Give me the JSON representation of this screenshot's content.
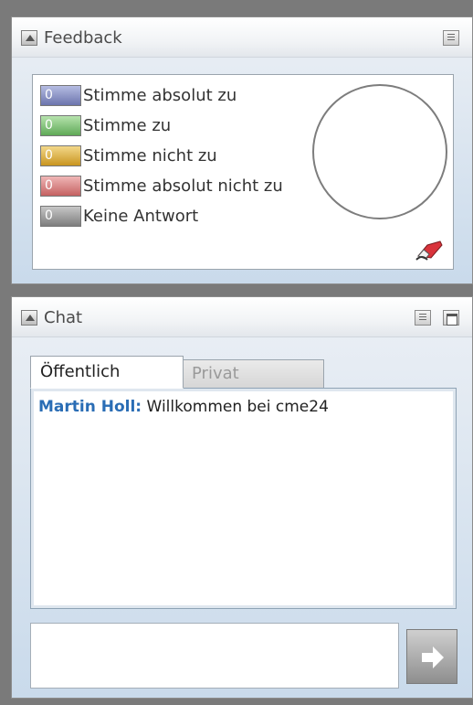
{
  "feedback": {
    "title": "Feedback",
    "legend": [
      {
        "label": "Stimme absolut zu",
        "count": "0",
        "color": "#8a93c4"
      },
      {
        "label": "Stimme zu",
        "count": "0",
        "color": "#7fbf78"
      },
      {
        "label": "Stimme nicht zu",
        "count": "0",
        "color": "#e0b63a"
      },
      {
        "label": "Stimme absolut nicht zu",
        "count": "0",
        "color": "#d98384"
      },
      {
        "label": "Keine Antwort",
        "count": "0",
        "color": "#9a9a9a"
      }
    ]
  },
  "chat": {
    "title": "Chat",
    "tabs": [
      "Öffentlich",
      "Privat"
    ],
    "active_tab": "Öffentlich",
    "messages": [
      {
        "sender": "Martin Holl:",
        "text": " Willkommen bei cme24"
      }
    ],
    "input_value": ""
  },
  "colors": {
    "sender": "#2a6db5"
  }
}
